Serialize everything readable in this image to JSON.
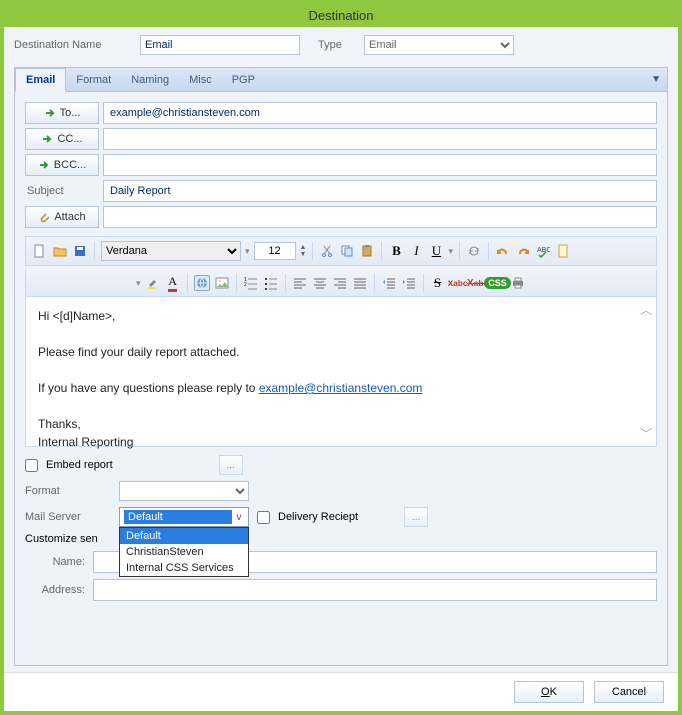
{
  "window": {
    "title": "Destination"
  },
  "header": {
    "dest_label": "Destination Name",
    "dest_value": "Email",
    "type_label": "Type",
    "type_value": "Email"
  },
  "tabs": [
    "Email",
    "Format",
    "Naming",
    "Misc",
    "PGP"
  ],
  "recipients": {
    "to_btn": "To...",
    "cc_btn": "CC...",
    "bcc_btn": "BCC...",
    "to_value": "example@christiansteven.com",
    "cc_value": "",
    "bcc_value": ""
  },
  "subject": {
    "label": "Subject",
    "value": "Daily Report"
  },
  "attach": {
    "label": "Attach",
    "value": ""
  },
  "editor": {
    "font": "Verdana",
    "size": "12",
    "body": {
      "greeting": "Hi <[d]Name>,",
      "line1": "Please find your daily report attached.",
      "line2a": "If you have any questions please reply to ",
      "link": "example@christiansteven.com",
      "thanks": "Thanks,",
      "sig": "Internal Reporting"
    }
  },
  "options": {
    "embed_label": "Embed report",
    "embed_checked": false,
    "format_label": "Format",
    "format_value": "",
    "mailserver_label": "Mail Server",
    "mailserver_value": "Default",
    "mailserver_options": [
      "Default",
      "ChristianSteven",
      "Internal CSS Services"
    ],
    "delivery_label": "Delivery Reciept",
    "delivery_checked": false,
    "customize_label": "Customize sen",
    "name_label": "Name:",
    "name_value": "",
    "address_label": "Address:",
    "address_value": ""
  },
  "footer": {
    "ok": "OK",
    "cancel": "Cancel"
  }
}
